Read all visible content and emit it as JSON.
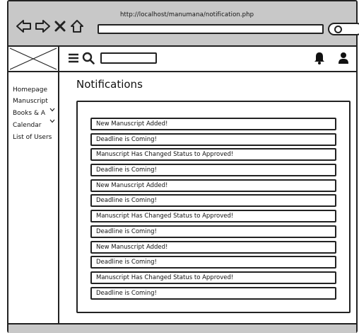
{
  "browser": {
    "url": "http://localhost/manumana/notification.php"
  },
  "sidebar": {
    "items": [
      {
        "label": "Homepage"
      },
      {
        "label": "Manuscript"
      },
      {
        "label": "Books & A"
      },
      {
        "label": "Calendar"
      },
      {
        "label": "List of Users"
      }
    ]
  },
  "main": {
    "title": "Notifications",
    "notifications": [
      "New Manuscript Added!",
      "Deadline is Coming!",
      "Manuscript Has Changed Status to Approved!",
      "Deadline is Coming!",
      "New Manuscript Added!",
      "Deadline is Coming!",
      "Manuscript Has Changed Status to Approved!",
      "Deadline is Coming!",
      "New Manuscript Added!",
      "Deadline is Coming!",
      "Manuscript Has Changed Status to Approved!",
      "Deadline is Coming!"
    ]
  },
  "icons": {
    "back": "back-arrow-icon",
    "forward": "forward-arrow-icon",
    "close": "close-icon",
    "home": "home-icon",
    "search": "search-icon",
    "menu": "hamburger-menu-icon",
    "bell": "bell-icon",
    "user": "user-icon"
  },
  "colors": {
    "chrome": "#c8c8c8",
    "stroke": "#222222"
  }
}
